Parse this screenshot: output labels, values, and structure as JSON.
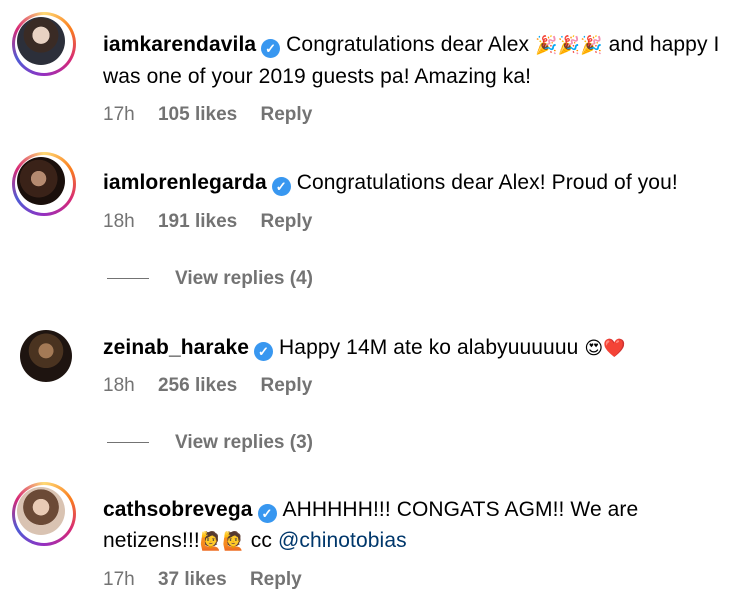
{
  "comments": [
    {
      "username": "iamkarendavila",
      "text_before_emoji": "Congratulations dear Alex ",
      "emoji": "🎉🎉🎉",
      "text_after_emoji": " and happy I was one of your 2019 guests pa! Amazing ka!",
      "time": "17h",
      "likes": "105 likes",
      "reply": "Reply"
    },
    {
      "username": "iamlorenlegarda",
      "text": "Congratulations dear Alex! Proud of you!",
      "time": "18h",
      "likes": "191 likes",
      "reply": "Reply",
      "view_replies": "View replies (4)"
    },
    {
      "username": "zeinab_harake",
      "text": "Happy 14M ate ko alabyuuuuuu ",
      "emoji": "😍❤️",
      "time": "18h",
      "likes": "256 likes",
      "reply": "Reply",
      "view_replies": "View replies (3)"
    },
    {
      "username": "cathsobrevega",
      "text": "AHHHHH!!! CONGATS AGM!! We are netizens!!!",
      "emoji": "🙋🙋",
      "text_cc": " cc ",
      "mention": "@chinotobias",
      "time": "17h",
      "likes": "37 likes",
      "reply": "Reply"
    }
  ],
  "verified_icon": "verified-badge-icon",
  "colors": {
    "verified": "#3897f0",
    "meta_gray": "#737373",
    "mention": "#00376b"
  }
}
